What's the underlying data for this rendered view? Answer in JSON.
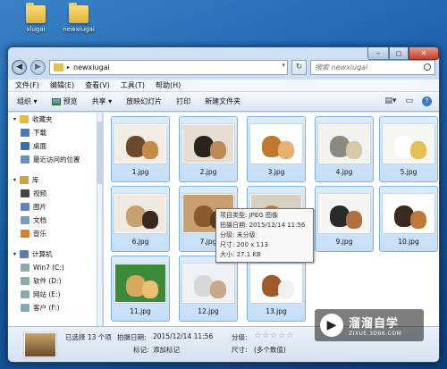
{
  "desktop": {
    "icons": [
      {
        "label": "xiugai"
      },
      {
        "label": "newxiugai"
      }
    ]
  },
  "window": {
    "path": "newxiugai",
    "search_placeholder": "搜索 newxiugai",
    "menu": [
      "文件(F)",
      "编辑(E)",
      "查看(V)",
      "工具(T)",
      "帮助(H)"
    ],
    "toolbar": [
      "组织 ▾",
      "预览",
      "共享 ▾",
      "放映幻灯片",
      "打印",
      "新建文件夹"
    ],
    "sidebar": [
      {
        "label": "收藏夹",
        "top": true,
        "color": "#e8b93a"
      },
      {
        "label": "下载",
        "color": "#4a78b8"
      },
      {
        "label": "桌面",
        "color": "#3b6fb0"
      },
      {
        "label": "最近访问的位置",
        "color": "#6a8fc0"
      },
      {
        "label": "",
        "spacer": true
      },
      {
        "label": "库",
        "top": true,
        "color": "#c9a24a"
      },
      {
        "label": "视频",
        "color": "#444"
      },
      {
        "label": "图片",
        "color": "#5b88c4"
      },
      {
        "label": "文档",
        "color": "#7d9ac0"
      },
      {
        "label": "音乐",
        "color": "#e07b2a"
      },
      {
        "label": "",
        "spacer": true
      },
      {
        "label": "计算机",
        "top": true,
        "color": "#5d7da8"
      },
      {
        "label": "Win7 (C:)",
        "color": "#8aa"
      },
      {
        "label": "软件 (D:)",
        "color": "#8aa"
      },
      {
        "label": "网站 (E:)",
        "color": "#8aa"
      },
      {
        "label": "客户 (F:)",
        "color": "#8aa"
      }
    ],
    "files": [
      {
        "name": "1.jpg",
        "colors": [
          "#6b4a2e",
          "#f1ece4",
          "#c48a46"
        ]
      },
      {
        "name": "2.jpg",
        "colors": [
          "#2a2420",
          "#e6ddd2",
          "#bb8a55"
        ]
      },
      {
        "name": "3.jpg",
        "colors": [
          "#c1772c",
          "#ffffff",
          "#e8b070"
        ]
      },
      {
        "name": "4.jpg",
        "colors": [
          "#8a8a80",
          "#f4f2ee",
          "#d8c8a8"
        ]
      },
      {
        "name": "5.jpg",
        "colors": [
          "#ffffff",
          "#f6f6f2",
          "#e8c050"
        ]
      },
      {
        "name": "6.jpg",
        "colors": [
          "#c8a070",
          "#efe9e0",
          "#3a2a20"
        ]
      },
      {
        "name": "7.jpg",
        "colors": [
          "#8a5a2e",
          "#c8a070",
          "#5a3a20"
        ]
      },
      {
        "name": "8.jpg",
        "colors": [
          "#b08050",
          "#d8d0c0",
          "#707070"
        ]
      },
      {
        "name": "9.jpg",
        "colors": [
          "#2a2a2a",
          "#f4f4f4",
          "#b07040"
        ]
      },
      {
        "name": "10.jpg",
        "colors": [
          "#3a2a20",
          "#ffffff",
          "#c07838"
        ]
      },
      {
        "name": "11.jpg",
        "colors": [
          "#d8a860",
          "#3a8a3a",
          "#e8c070"
        ]
      },
      {
        "name": "12.jpg",
        "colors": [
          "#d8d8d8",
          "#eef2f4",
          "#c8a888"
        ]
      },
      {
        "name": "13.jpg",
        "colors": [
          "#a05a2a",
          "#ffffff",
          "#f0f0f0"
        ]
      }
    ],
    "tooltip": {
      "type": "项目类型: JPEG 图像",
      "date": "拍摄日期: 2015/12/14 11:56",
      "rating": "分级: 未分级",
      "size": "尺寸: 200 x 113",
      "filesize": "大小: 27.1 KB"
    },
    "status": {
      "selected": "已选择 13 个项",
      "date_label": "拍摄日期:",
      "date_value": "2015/12/14 11:56",
      "tag_label": "标记:",
      "tag_value": "添加标记",
      "rating_label": "分级:",
      "rating_stars": "☆☆☆☆☆",
      "size_label": "尺寸:",
      "size_value": "(多个数值)"
    }
  },
  "watermark": {
    "logo": "▶",
    "title": "溜溜自学",
    "url": "ZIXUE.3D66.COM"
  }
}
